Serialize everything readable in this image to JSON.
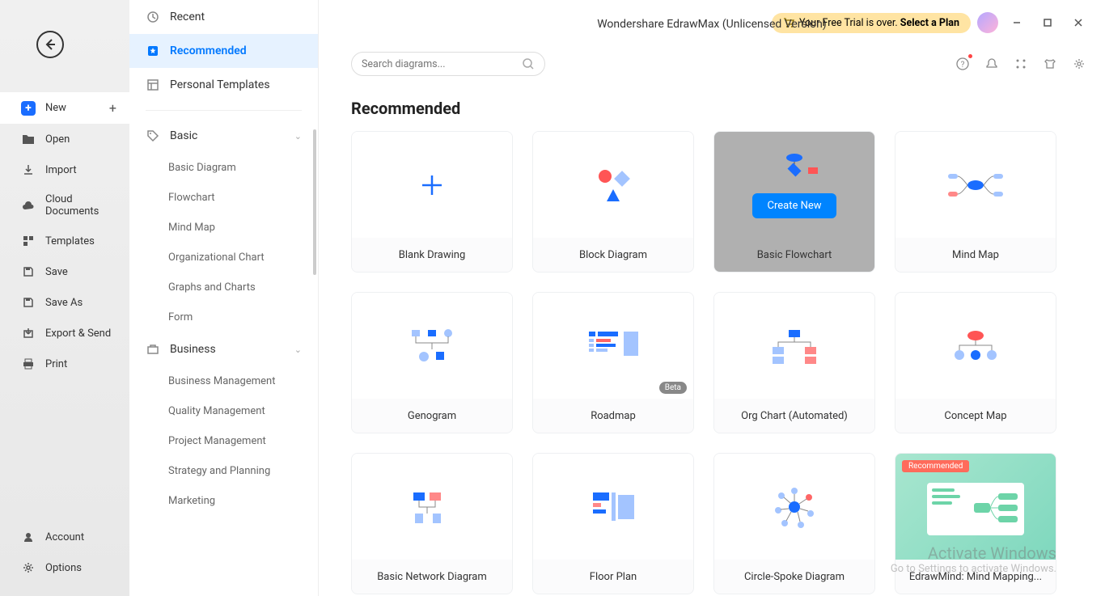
{
  "app": {
    "title": "Wondershare EdrawMax (Unlicensed Version)"
  },
  "trial": {
    "text1": "Your Free Trial is over. ",
    "text2": "Select a Plan"
  },
  "search": {
    "placeholder": "Search diagrams..."
  },
  "leftnav": {
    "new": "New",
    "open": "Open",
    "import": "Import",
    "cloud": "Cloud Documents",
    "templates": "Templates",
    "save": "Save",
    "saveas": "Save As",
    "export": "Export & Send",
    "print": "Print",
    "account": "Account",
    "options": "Options"
  },
  "categories": {
    "recent": "Recent",
    "recommended": "Recommended",
    "personal": "Personal Templates",
    "basic": "Basic",
    "basic_items": [
      "Basic Diagram",
      "Flowchart",
      "Mind Map",
      "Organizational Chart",
      "Graphs and Charts",
      "Form"
    ],
    "business": "Business",
    "business_items": [
      "Business Management",
      "Quality Management",
      "Project Management",
      "Strategy and Planning",
      "Marketing"
    ]
  },
  "section": {
    "title": "Recommended"
  },
  "cards": [
    {
      "label": "Blank Drawing"
    },
    {
      "label": "Block Diagram"
    },
    {
      "label": "Basic Flowchart",
      "hovered": true,
      "cta": "Create New"
    },
    {
      "label": "Mind Map"
    },
    {
      "label": "Genogram"
    },
    {
      "label": "Roadmap",
      "badge": "Beta"
    },
    {
      "label": "Org Chart (Automated)"
    },
    {
      "label": "Concept Map"
    },
    {
      "label": "Basic Network Diagram"
    },
    {
      "label": "Floor Plan"
    },
    {
      "label": "Circle-Spoke Diagram"
    },
    {
      "label": "EdrawMind: Mind Mapping...",
      "recommended": "Recommended",
      "green": true
    }
  ],
  "watermark": {
    "l1": "Activate Windows",
    "l2": "Go to Settings to activate Windows."
  }
}
